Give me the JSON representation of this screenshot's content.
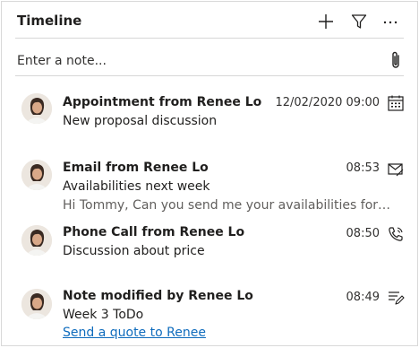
{
  "header": {
    "title": "Timeline",
    "add_icon": "plus-icon",
    "filter_icon": "filter-icon",
    "more_icon": "more-ellipsis-icon"
  },
  "note": {
    "placeholder": "Enter a note...",
    "attach_icon": "paperclip-icon"
  },
  "entries": [
    {
      "title": "Appointment from Renee Lo",
      "subtitle": "New proposal discussion",
      "time": "12/02/2020 09:00",
      "icon": "calendar-icon"
    },
    {
      "title": "Email from Renee Lo",
      "subtitle": "Availabilities next week",
      "preview": "Hi Tommy, Can you send me your availabilities for our meeting next week?",
      "time": "08:53",
      "icon": "email-icon"
    },
    {
      "title": "Phone Call from Renee Lo",
      "subtitle": "Discussion about price",
      "time": "08:50",
      "icon": "phone-icon"
    },
    {
      "title": "Note modified by Renee Lo",
      "subtitle": "Week 3 ToDo",
      "link": "Send a quote to Renee",
      "time": "08:49",
      "icon": "note-icon"
    }
  ],
  "colors": {
    "link": "#0f6cbd",
    "text": "#201f1e",
    "muted": "#605e5c",
    "divider": "#d6d6d6"
  }
}
